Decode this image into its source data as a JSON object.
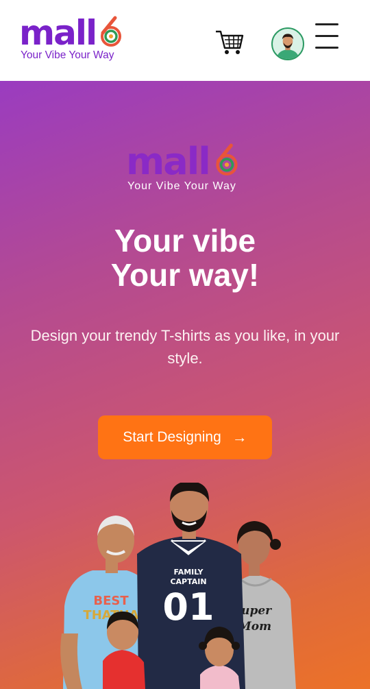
{
  "header": {
    "logo_word": "mall",
    "logo_tagline": "Your Vibe Your Way",
    "cart_icon": "cart-icon",
    "avatar_icon": "user-avatar",
    "menu_icon": "hamburger-menu-icon"
  },
  "hero": {
    "logo_word": "mall",
    "logo_tagline": "Your Vibe Your Way",
    "headline_line1": "Your vibe",
    "headline_line2": "Your way!",
    "subtitle": "Design your trendy T-shirts as you like, in your style.",
    "cta_label": "Start Designing",
    "cta_icon": "arrow-right-icon",
    "image": {
      "shirt_jersey": "FAMILY CAPTAIN",
      "shirt_jersey_number": "01",
      "shirt_grandpa": "BEST THATHA",
      "shirt_mom": "Super Mom"
    }
  },
  "colors": {
    "brand_purple": "#7a22c9",
    "cta_orange": "#ff7314",
    "gradient_start": "#9a3cc0",
    "gradient_end": "#ec7228"
  }
}
